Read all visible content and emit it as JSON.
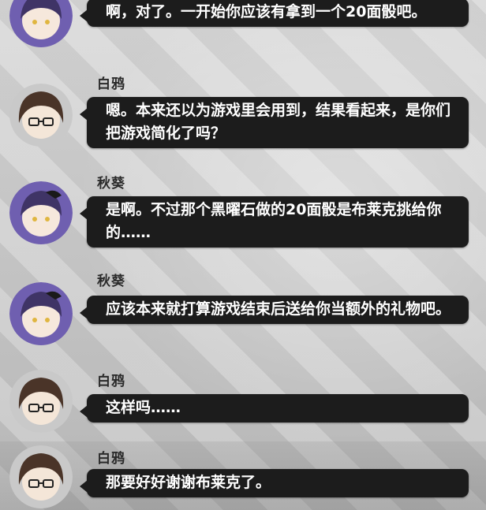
{
  "dialogue": [
    {
      "speaker": "",
      "text": "啊，对了。一开始你应该有拿到一个20面骰吧。",
      "avatar": "qiukui-avatar"
    },
    {
      "speaker": "白鸦",
      "text": "嗯。本来还以为游戏里会用到，结果看起来，是你们把游戏简化了吗？",
      "avatar": "baiya-avatar"
    },
    {
      "speaker": "秋葵",
      "text": "是啊。不过那个黑曜石做的20面骰是布莱克挑给你的……",
      "avatar": "qiukui-avatar"
    },
    {
      "speaker": "秋葵",
      "text": "应该本来就打算游戏结束后送给你当额外的礼物吧。",
      "avatar": "qiukui-avatar"
    },
    {
      "speaker": "白鸦",
      "text": "这样吗……",
      "avatar": "baiya-avatar"
    },
    {
      "speaker": "白鸦",
      "text": "那要好好谢谢布莱克了。",
      "avatar": "baiya-avatar"
    }
  ],
  "colors": {
    "bubble": "#1c1c1c",
    "bubble_text": "#ffffff",
    "name_text": "#2a2a2a",
    "qiukui_hair": "#5a4a8c",
    "baiya_hair": "#4a3428"
  }
}
